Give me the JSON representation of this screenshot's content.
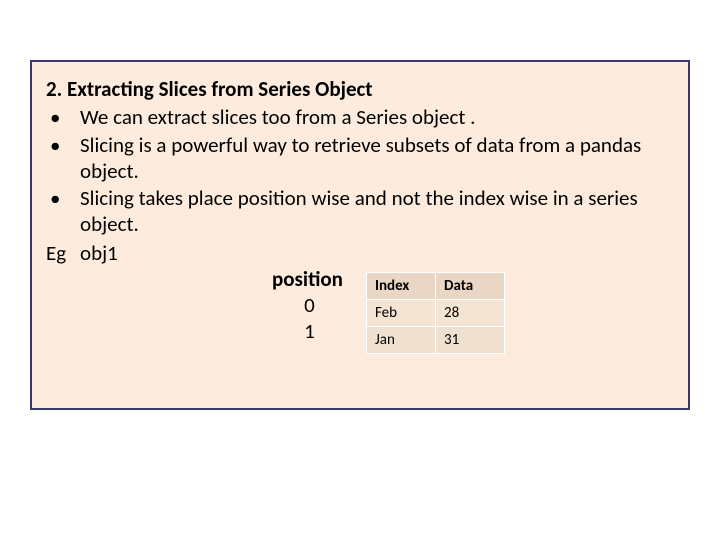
{
  "title": "2.  Extracting Slices from Series Object",
  "bullets": [
    "We can extract slices too from a Series object .",
    "Slicing is a powerful way to retrieve subsets of data from a pandas  object.",
    "Slicing takes place position wise and not the index wise in a series object."
  ],
  "eg_label": "Eg",
  "eg_obj": "obj1",
  "position_header": "position",
  "positions": [
    "0",
    "1"
  ],
  "table": {
    "headers": [
      "Index",
      "Data"
    ],
    "rows": [
      [
        "Feb",
        "28"
      ],
      [
        "Jan",
        "31"
      ]
    ]
  }
}
